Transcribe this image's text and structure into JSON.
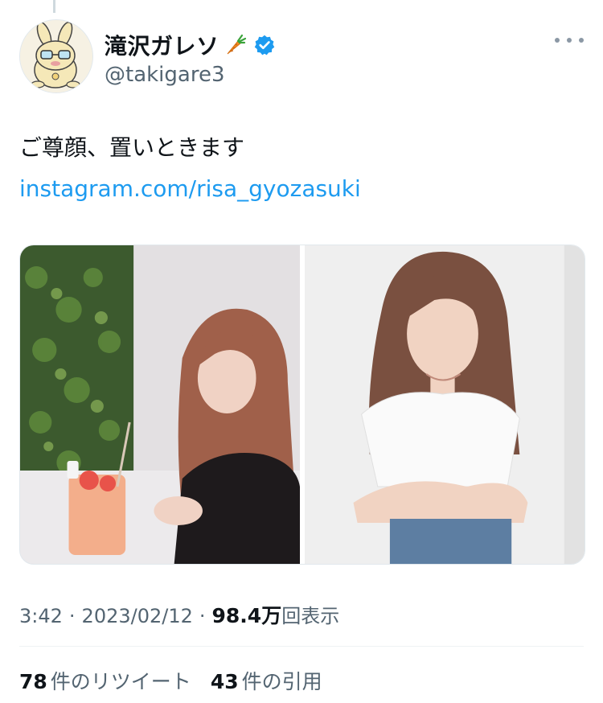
{
  "tweet": {
    "author": {
      "display_name": "滝沢ガレソ",
      "handle": "@takigare3",
      "verified": true,
      "name_emoji": "carrot-icon"
    },
    "text": "ご尊顔、置いときます",
    "link": "instagram.com/risa_gyozasuki",
    "media": [
      {
        "name": "photo-cafe-drink"
      },
      {
        "name": "photo-portrait"
      }
    ],
    "time": "3:42",
    "date": "2023/02/12",
    "views_count": "98.4万",
    "views_label": "回表示",
    "separator": "·",
    "stats": {
      "retweets_count": "78",
      "retweets_label": "件のリツイート",
      "quotes_count": "43",
      "quotes_label": "件の引用"
    }
  },
  "colors": {
    "link": "#1d9bf0",
    "secondary_text": "#536471",
    "verified_badge": "#1d9bf0"
  }
}
